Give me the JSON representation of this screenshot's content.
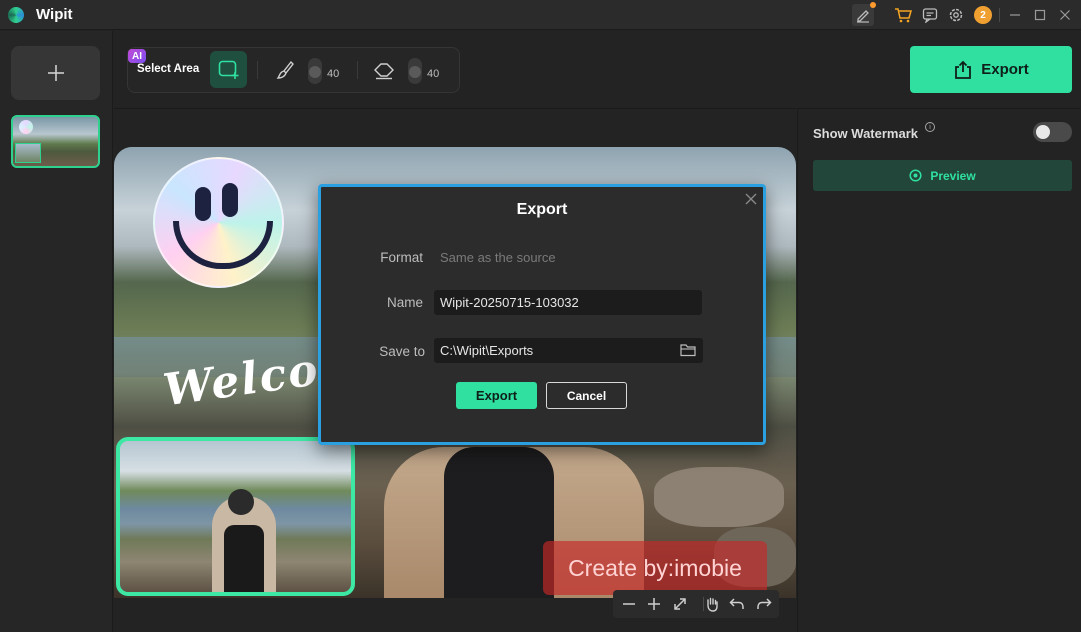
{
  "app": {
    "title": "Wipit",
    "notification_count": "2"
  },
  "toolbar": {
    "ai_badge": "AI",
    "select_area_label": "Select Area",
    "brush_size": "40",
    "eraser_size": "40"
  },
  "export_button": {
    "label": "Export"
  },
  "right_panel": {
    "show_watermark_label": "Show Watermark",
    "info_glyph": "i",
    "watermark_enabled": false,
    "preview_label": "Preview"
  },
  "canvas": {
    "overlay_text": "Welcor",
    "watermark_text": "Create by:imobie"
  },
  "dialog": {
    "title": "Export",
    "format_label": "Format",
    "format_value": "Same as the source",
    "name_label": "Name",
    "name_value": "Wipit-20250715-103032",
    "save_to_label": "Save to",
    "save_to_value": "C:\\Wipit\\Exports",
    "export_button": "Export",
    "cancel_button": "Cancel"
  },
  "colors": {
    "accent": "#2fe0a0",
    "dialog_border": "#2aa0e0",
    "background": "#232323"
  },
  "icons": {
    "titlebar": [
      "edit-icon",
      "cart-icon",
      "feedback-icon",
      "settings-icon",
      "avatar-icon",
      "minimize-icon",
      "maximize-icon",
      "close-icon"
    ],
    "toolbar": [
      "select-area-icon",
      "brush-icon",
      "eraser-icon"
    ],
    "zoombar": [
      "zoom-out-icon",
      "zoom-in-icon",
      "fit-icon",
      "hand-icon",
      "undo-icon",
      "redo-icon"
    ]
  }
}
